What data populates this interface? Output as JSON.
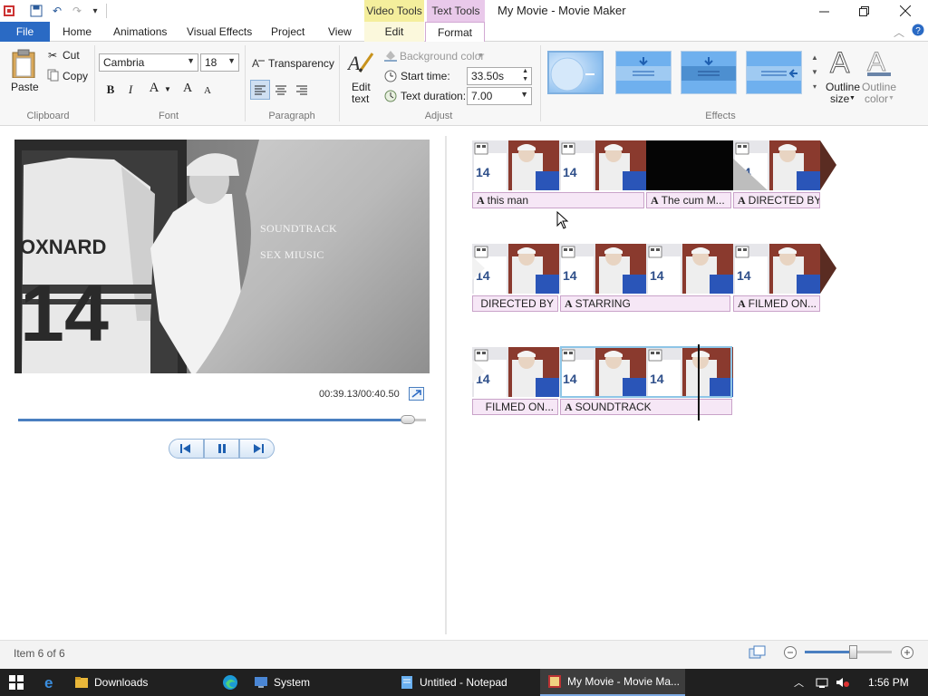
{
  "titlebar": {
    "window_title": "My Movie - Movie Maker",
    "contextual_video": "Video Tools",
    "contextual_text": "Text Tools",
    "minimize": "—",
    "maximize": "❐",
    "close": "✕"
  },
  "tabs": {
    "file": "File",
    "home": "Home",
    "animations": "Animations",
    "visual_effects": "Visual Effects",
    "project": "Project",
    "view": "View",
    "edit": "Edit",
    "format": "Format"
  },
  "ribbon": {
    "clipboard": {
      "paste": "Paste",
      "cut": "Cut",
      "copy": "Copy",
      "label": "Clipboard"
    },
    "font": {
      "family": "Cambria",
      "size": "18",
      "bold": "B",
      "italic": "I",
      "color": "A",
      "grow": "A",
      "shrink": "A",
      "label": "Font"
    },
    "paragraph": {
      "transparency": "Transparency",
      "label": "Paragraph"
    },
    "adjust": {
      "edit_text": "Edit",
      "edit_text2": "text",
      "background_color": "Background color",
      "start_time_label": "Start time:",
      "start_time_value": "33.50s",
      "duration_label": "Text duration:",
      "duration_value": "7.00",
      "label": "Adjust"
    },
    "effects": {
      "label": "Effects",
      "outline_size": "Outline",
      "outline_size2": "size",
      "outline_color": "Outline",
      "outline_color2": "color"
    }
  },
  "preview": {
    "line1": "SOUNDTRACK",
    "line2": "SEX MIUSIC",
    "jersey_name": "OXNARD",
    "jersey_number": "14",
    "timecode": "00:39.13/00:40.50",
    "progress": 0.955
  },
  "storyboard": {
    "row1": [
      "this man",
      "The cum M...",
      "DIRECTED BY"
    ],
    "row2": [
      "DIRECTED BY",
      "STARRING",
      "FILMED ON..."
    ],
    "row3": [
      "FILMED ON...",
      "SOUNDTRACK"
    ]
  },
  "status": {
    "item": "Item 6 of 6",
    "zoom": 0.56
  },
  "taskbar": {
    "items": [
      "Downloads",
      "System",
      "Untitled - Notepad",
      "My Movie - Movie Ma..."
    ],
    "time": "1:56 PM"
  },
  "colors": {
    "accent": "#2a6ac4",
    "text_tools": "#e9c9ea",
    "video_tools": "#f4ee9c",
    "caption_bg": "#f6e7f6"
  }
}
